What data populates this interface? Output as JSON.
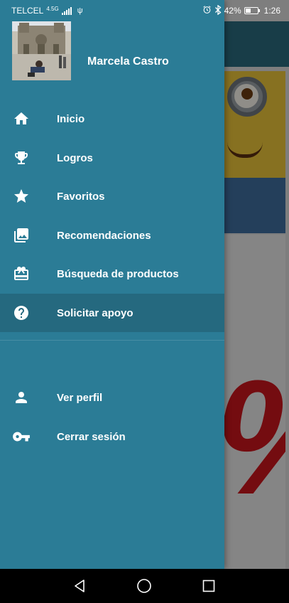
{
  "status_bar": {
    "carrier": "TELCEL",
    "network": "4.5G",
    "battery_percent": "42%",
    "battery_level": 0.42,
    "time": "1:26"
  },
  "drawer": {
    "user_name": "Marcela Castro",
    "menu": [
      {
        "label": "Inicio",
        "icon": "home-icon"
      },
      {
        "label": "Logros",
        "icon": "trophy-icon"
      },
      {
        "label": "Favoritos",
        "icon": "star-icon"
      },
      {
        "label": "Recomendaciones",
        "icon": "photo-library-icon"
      },
      {
        "label": "Búsqueda de productos",
        "icon": "gift-card-icon"
      },
      {
        "label": "Solicitar apoyo",
        "icon": "help-icon",
        "active": true
      }
    ],
    "account_menu": [
      {
        "label": "Ver perfil",
        "icon": "person-icon"
      },
      {
        "label": "Cerrar sesión",
        "icon": "key-icon"
      }
    ]
  },
  "background": {
    "promo_text": "%"
  },
  "colors": {
    "drawer_bg": "#2b7c96",
    "drawer_active_bg": "#25697f",
    "topbar_bg": "#2a6a7c",
    "text": "#ffffff"
  }
}
